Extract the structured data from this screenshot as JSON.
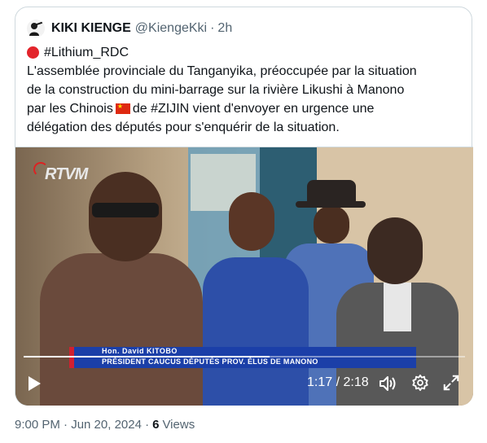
{
  "tweet": {
    "author_name": "KIKI KIENGE",
    "handle": "@KiengeKki",
    "separator": "·",
    "relative_time": "2h",
    "lines": [
      "#Lithium_RDC",
      "L'assemblée provinciale du Tanganyika, préoccupée par la situation",
      "de la construction du mini-barrage sur la rivière Likushi à Manono",
      "par les Chinois",
      "de #ZIJIN vient d'envoyer en urgence une",
      "délégation des députés pour s'enquérir de la situation."
    ],
    "emoji": {
      "bullet": "red-circle",
      "flag": "china-flag"
    }
  },
  "video": {
    "channel_logo": "RTVM",
    "lower_third_name": "Hon. David KITOBO",
    "lower_third_title": "PRÉSIDENT CAUCUS DÉPUTÉS PROV. ÉLUS DE MANONO",
    "current_time": "1:17",
    "time_separator": " / ",
    "duration": "2:18",
    "progress": 0.558,
    "controls": {
      "play": "play-icon",
      "volume": "volume-icon",
      "settings": "gear-icon",
      "fullscreen": "fullscreen-icon"
    }
  },
  "meta": {
    "datetime": "9:00 PM · Jun 20, 2024 ·",
    "views_count": "6",
    "views_label": "Views"
  },
  "colors": {
    "text_primary": "#0f1419",
    "text_secondary": "#536471",
    "border": "#cfd9de",
    "lower_third_blue": "#1b3fa8"
  }
}
